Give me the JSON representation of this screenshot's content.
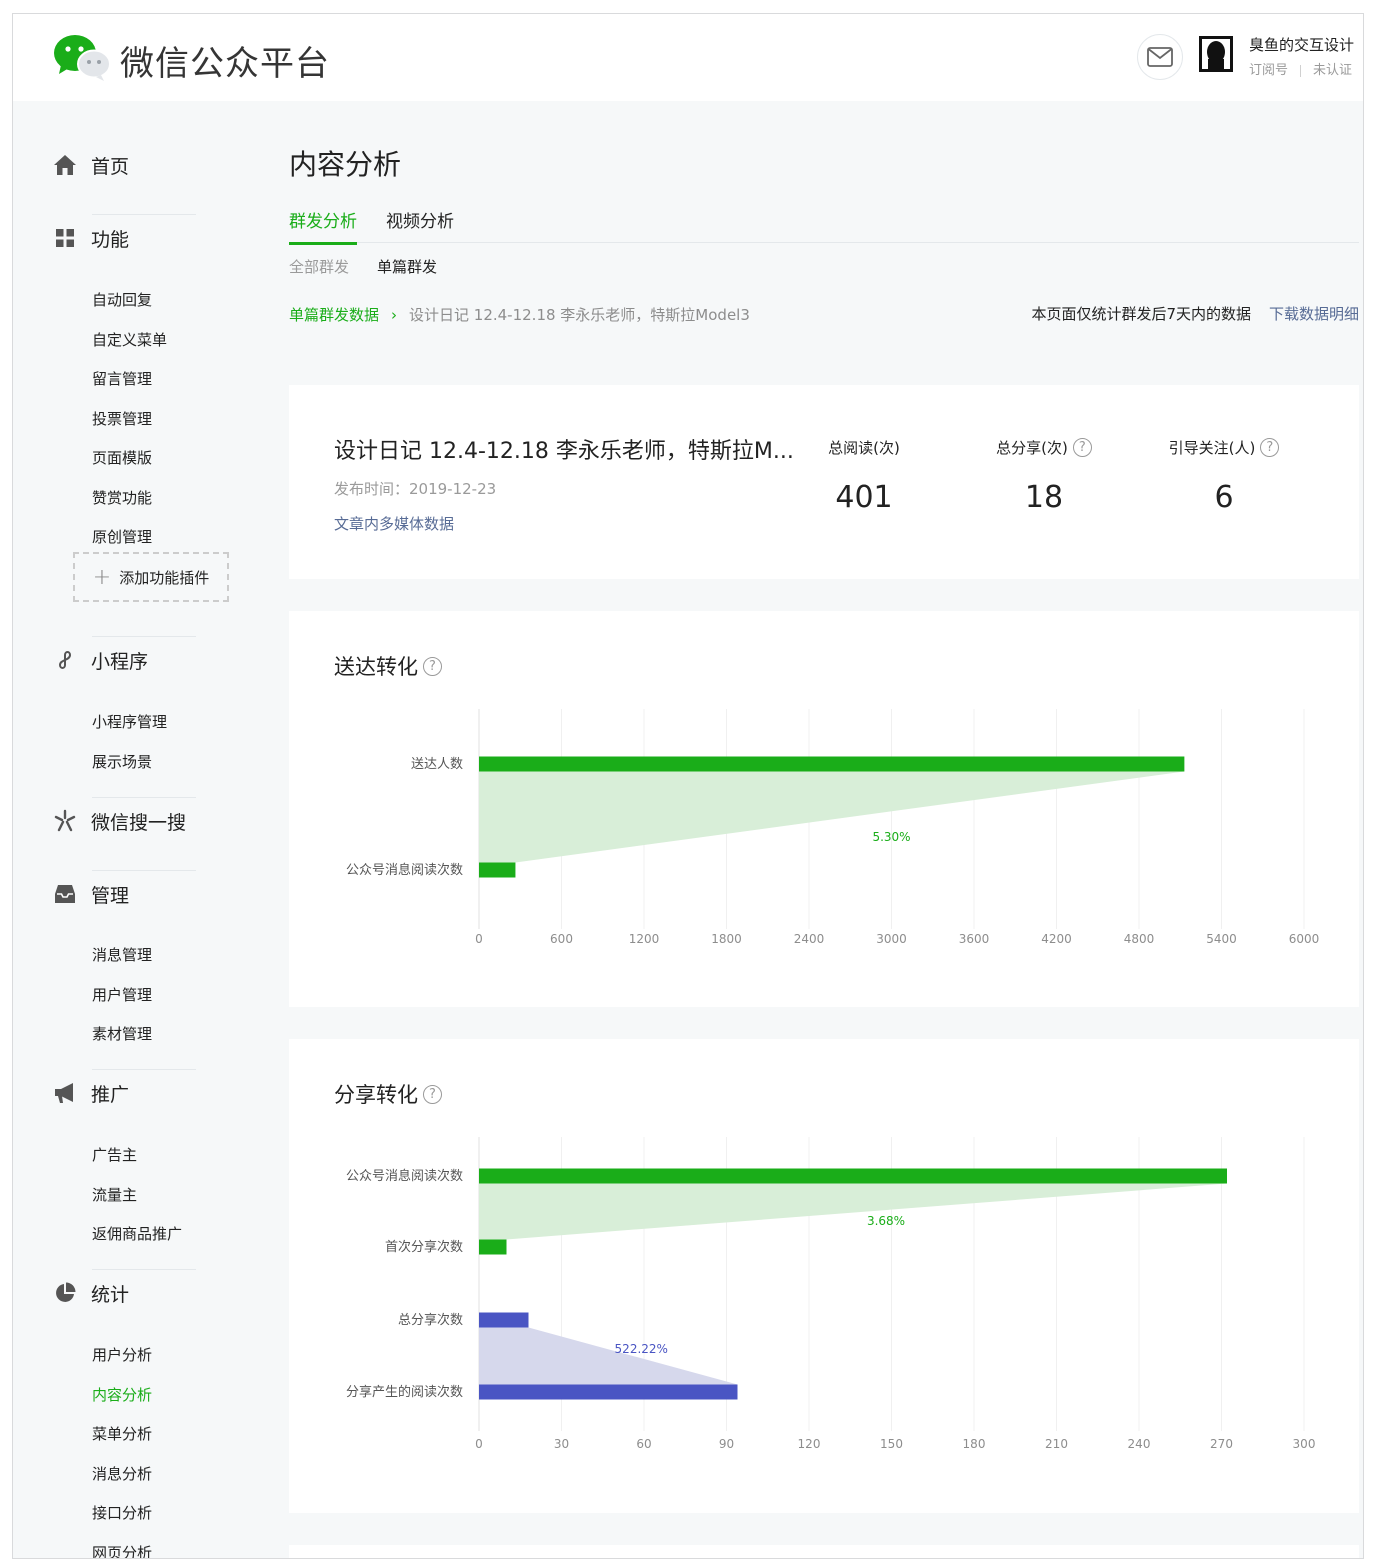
{
  "header": {
    "brand": "微信公众平台",
    "account_name": "臭鱼的交互设计",
    "account_type": "订阅号",
    "account_status": "未认证",
    "icons": [
      "wechat-logo",
      "mail-icon",
      "avatar"
    ]
  },
  "sidebar": {
    "home": "首页",
    "features": {
      "label": "功能",
      "items": [
        "自动回复",
        "自定义菜单",
        "留言管理",
        "投票管理",
        "页面模版",
        "赞赏功能",
        "原创管理"
      ],
      "add_plugin": "添加功能插件"
    },
    "miniprogram": {
      "label": "小程序",
      "items": [
        "小程序管理",
        "展示场景"
      ]
    },
    "search": {
      "label": "微信搜一搜"
    },
    "manage": {
      "label": "管理",
      "items": [
        "消息管理",
        "用户管理",
        "素材管理"
      ]
    },
    "promote": {
      "label": "推广",
      "items": [
        "广告主",
        "流量主",
        "返佣商品推广"
      ]
    },
    "stats": {
      "label": "统计",
      "items": [
        "用户分析",
        "内容分析",
        "菜单分析",
        "消息分析",
        "接口分析",
        "网页分析"
      ],
      "active": "内容分析"
    }
  },
  "main": {
    "title": "内容分析",
    "tabs": [
      "群发分析",
      "视频分析"
    ],
    "active_tab": "群发分析",
    "subtabs": [
      "全部群发",
      "单篇群发"
    ],
    "active_subtab": "单篇群发",
    "breadcrumb": {
      "link": "单篇群发数据",
      "current": "设计日记 12.4-12.18 李永乐老师，特斯拉Model3"
    },
    "notice": "本页面仅统计群发后7天内的数据",
    "download": "下载数据明细",
    "article": {
      "title": "设计日记 12.4-12.18 李永乐老师，特斯拉M...",
      "date": "发布时间：2019-12-23",
      "media_link": "文章内多媒体数据",
      "stats": [
        {
          "label": "总阅读(次)",
          "value": "401",
          "help": false
        },
        {
          "label": "总分享(次)",
          "value": "18",
          "help": true
        },
        {
          "label": "引导关注(人)",
          "value": "6",
          "help": true
        }
      ]
    },
    "help_mark": "?"
  },
  "chart_data": [
    {
      "type": "bar",
      "title": "送达转化",
      "orientation": "horizontal",
      "categories": [
        "送达人数",
        "公众号消息阅读次数"
      ],
      "values": [
        5130,
        265
      ],
      "xlim": [
        0,
        6000
      ],
      "xticks": [
        "0",
        "600",
        "1200",
        "1800",
        "2400",
        "3000",
        "3600",
        "4200",
        "4800",
        "5400",
        "6000"
      ],
      "conversion_label": "5.30%",
      "color": "#1aad19",
      "funnel_color": "#d8eed8",
      "grid": true
    },
    {
      "type": "bar",
      "title": "分享转化",
      "orientation": "horizontal",
      "categories": [
        "公众号消息阅读次数",
        "首次分享次数",
        "总分享次数",
        "分享产生的阅读次数"
      ],
      "values": [
        272,
        10,
        18,
        94
      ],
      "xlim": [
        0,
        300
      ],
      "xticks": [
        "0",
        "30",
        "60",
        "90",
        "120",
        "150",
        "180",
        "210",
        "240",
        "270",
        "300"
      ],
      "conversion_labels": [
        "3.68%",
        "522.22%"
      ],
      "colors": [
        "#1aad19",
        "#1aad19",
        "#4a55c3",
        "#4a55c3"
      ],
      "funnel_colors": [
        "#d8eed8",
        "#d6d8ec"
      ],
      "grid": true
    }
  ]
}
